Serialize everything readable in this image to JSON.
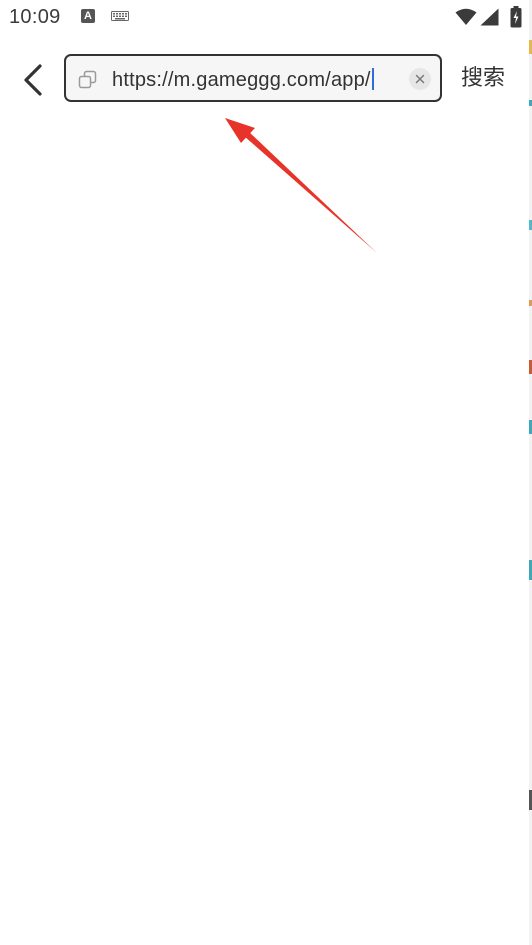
{
  "status_bar": {
    "time": "10:09",
    "notification_icon": "a-icon",
    "notification_letter": "A",
    "keyboard_icon": "keyboard-icon",
    "wifi_icon": "wifi-icon",
    "signal_icon": "signal-icon",
    "battery_icon": "battery-icon"
  },
  "header": {
    "back_icon": "chevron-left-icon",
    "search": {
      "value": "https://m.gameggg.com/app/",
      "leading_icon": "copy-icon",
      "clear_icon": "close-icon"
    },
    "search_button_label": "搜索"
  },
  "annotation": {
    "type": "arrow",
    "color": "#e8332a"
  },
  "colors": {
    "caret": "#2f6bd9",
    "border": "#333333",
    "text": "#333333",
    "annotation": "#e8332a"
  }
}
